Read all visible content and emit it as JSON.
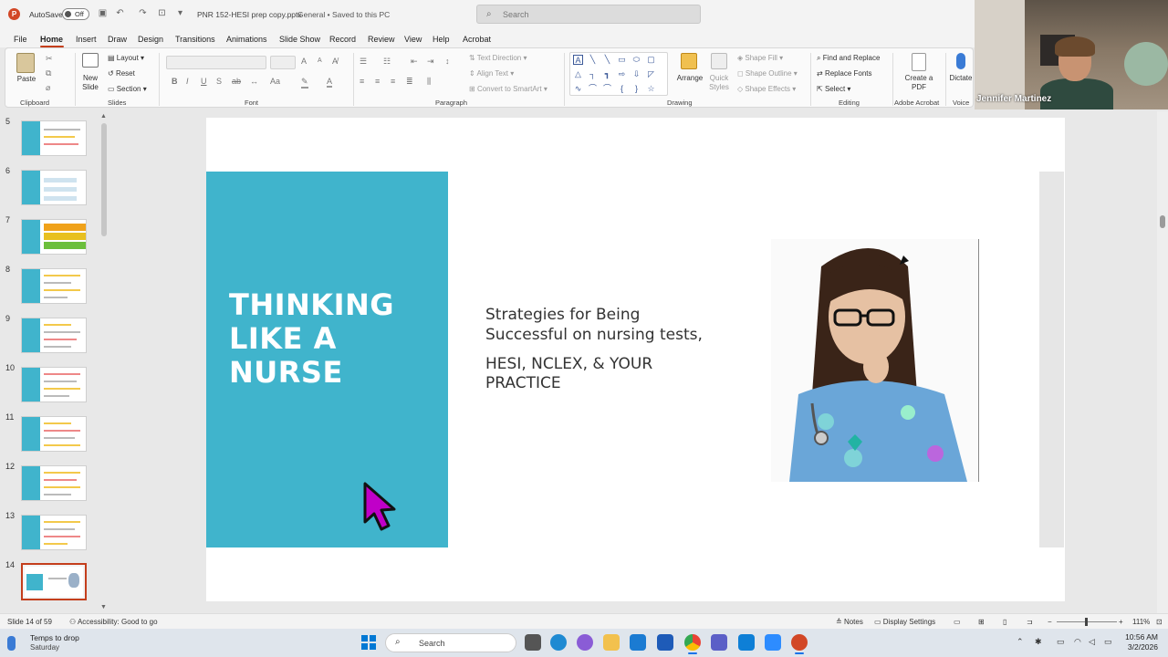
{
  "titlebar": {
    "logo_letter": "P",
    "autosave_label": "AutoSave",
    "autosave_state": "Off",
    "doc_title": "PNR 152-HESI prep copy.pptx",
    "doc_status": "General • Saved to this PC",
    "search_placeholder": "Search",
    "search_icon": "search-icon"
  },
  "menu": {
    "tabs": [
      "File",
      "Home",
      "Insert",
      "Draw",
      "Design",
      "Transitions",
      "Animations",
      "Slide Show",
      "Record",
      "Review",
      "View",
      "Help",
      "Acrobat"
    ],
    "active": "Home"
  },
  "ribbon": {
    "clipboard": {
      "paste": "Paste",
      "label": "Clipboard"
    },
    "slides": {
      "new_slide": "New Slide",
      "layout": "Layout",
      "reset": "Reset",
      "section": "Section",
      "label": "Slides"
    },
    "font": {
      "label": "Font"
    },
    "paragraph": {
      "text_direction": "Text Direction",
      "align_text": "Align Text",
      "convert_smartart": "Convert to SmartArt",
      "label": "Paragraph"
    },
    "drawing": {
      "arrange": "Arrange",
      "quick_styles": "Quick Styles",
      "shape_fill": "Shape Fill",
      "shape_outline": "Shape Outline",
      "shape_effects": "Shape Effects",
      "label": "Drawing"
    },
    "editing": {
      "find_replace": "Find and Replace",
      "replace_fonts": "Replace Fonts",
      "select": "Select",
      "label": "Editing"
    },
    "acrobat": {
      "create_pdf": "Create a PDF",
      "label": "Adobe Acrobat"
    },
    "voice": {
      "dictate": "Dictate",
      "label": "Voice"
    }
  },
  "webcam": {
    "participant_name": "Jennifer Martinez"
  },
  "thumbnails": [
    {
      "num": "5"
    },
    {
      "num": "6"
    },
    {
      "num": "7"
    },
    {
      "num": "8"
    },
    {
      "num": "9"
    },
    {
      "num": "10"
    },
    {
      "num": "11"
    },
    {
      "num": "12"
    },
    {
      "num": "13"
    },
    {
      "num": "14",
      "selected": true
    }
  ],
  "slide": {
    "title": "THINKING LIKE A NURSE",
    "subtitle_line1": "Strategies for Being",
    "subtitle_line2": "Successful on nursing tests,",
    "subtitle2_line1": "HESI, NCLEX, & YOUR",
    "subtitle2_line2": "PRACTICE",
    "teal_color": "#40b4cc"
  },
  "statusbar": {
    "slide_count": "Slide 14 of 59",
    "accessibility": "Accessibility: Good to go",
    "notes": "Notes",
    "display_settings": "Display Settings",
    "zoom": "111%"
  },
  "taskbar": {
    "weather_line1": "Temps to drop",
    "weather_line2": "Saturday",
    "search_placeholder": "Search",
    "time": "10:56 AM",
    "date": "3/2/2026"
  }
}
